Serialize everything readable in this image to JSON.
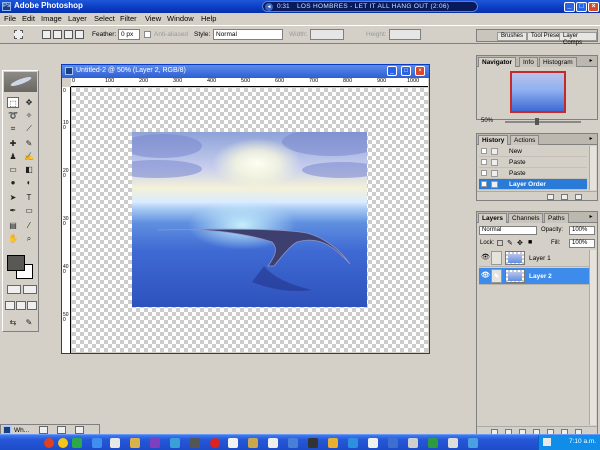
{
  "app": {
    "title": "Adobe Photoshop",
    "media_time": "0:31",
    "media_track": "LOS HOMBRES - LET IT ALL HANG OUT (2:06)",
    "window_buttons": [
      "_",
      "□",
      "×"
    ]
  },
  "menu": [
    "File",
    "Edit",
    "Image",
    "Layer",
    "Select",
    "Filter",
    "View",
    "Window",
    "Help"
  ],
  "options_bar": {
    "feather_label": "Feather:",
    "feather_value": "0 px",
    "antialiased_label": "Anti-aliased",
    "style_label": "Style:",
    "style_value": "Normal",
    "width_label": "Width:",
    "height_label": "Height:",
    "well_tabs": [
      "Brushes",
      "Tool Presets",
      "Layer Comps"
    ]
  },
  "document": {
    "title": "Untitled-2 @ 50% (Layer 2, RGB/8)",
    "ruler_h": [
      "0",
      "100",
      "200",
      "300",
      "400",
      "500",
      "600",
      "700",
      "800",
      "900",
      "1000"
    ],
    "ruler_v": [
      "0",
      "100",
      "200",
      "300",
      "400",
      "500"
    ]
  },
  "navigator": {
    "tabs": [
      "Navigator",
      "Info",
      "Histogram"
    ],
    "zoom": "50%"
  },
  "history": {
    "tabs": [
      "History",
      "Actions"
    ],
    "items": [
      "New",
      "Paste",
      "Paste",
      "Layer Order"
    ],
    "selected_index": 3
  },
  "layers": {
    "tabs": [
      "Layers",
      "Channels",
      "Paths"
    ],
    "blend_mode": "Normal",
    "opacity_label": "Opacity:",
    "opacity_value": "100%",
    "lock_label": "Lock:",
    "fill_label": "Fill:",
    "fill_value": "100%",
    "items": [
      "Layer 1",
      "Layer 2"
    ],
    "selected_index": 1
  },
  "taskbar": {
    "mini_window": "Wh...",
    "clock": "7:10 a.m."
  },
  "colors": {
    "xp_blue": "#0a3cc3",
    "selection_blue": "#3d8bea",
    "navigator_frame": "#c42a2a"
  }
}
